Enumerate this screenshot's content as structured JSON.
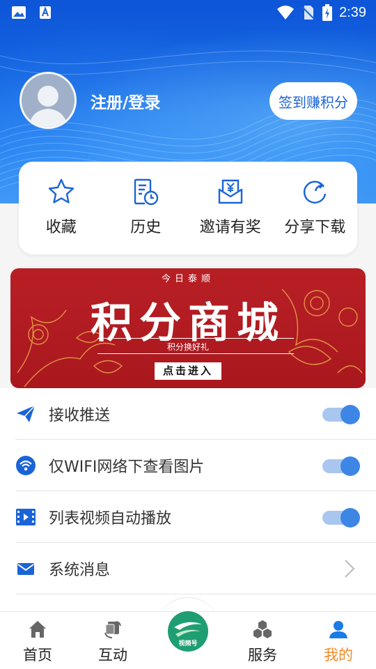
{
  "status_bar": {
    "time": "2:39",
    "icons": [
      "gallery-icon",
      "text-a-icon",
      "wifi-icon",
      "no-sim-icon",
      "battery-charging-icon"
    ]
  },
  "profile": {
    "login_text": "注册/登录",
    "signin_button": "签到赚积分"
  },
  "quick_actions": [
    {
      "label": "收藏",
      "icon": "star-icon"
    },
    {
      "label": "历史",
      "icon": "history-icon"
    },
    {
      "label": "邀请有奖",
      "icon": "invite-reward-icon"
    },
    {
      "label": "分享下载",
      "icon": "share-icon"
    }
  ],
  "banner": {
    "top_text": "今日泰顺",
    "title": "积分商城",
    "subtitle": "积分换好礼",
    "button": "点击进入"
  },
  "settings": [
    {
      "label": "接收推送",
      "icon": "send-icon",
      "control": "toggle",
      "on": true
    },
    {
      "label": "仅WIFI网络下查看图片",
      "icon": "wifi-circle-icon",
      "control": "toggle",
      "on": true
    },
    {
      "label": "列表视频自动播放",
      "icon": "video-icon",
      "control": "toggle",
      "on": true
    },
    {
      "label": "系统消息",
      "icon": "mail-icon",
      "control": "chevron"
    }
  ],
  "tabbar": [
    {
      "label": "首页",
      "icon": "home-icon"
    },
    {
      "label": "互动",
      "icon": "interaction-icon"
    },
    {
      "label": "视频号",
      "icon": "video-channel-logo"
    },
    {
      "label": "服务",
      "icon": "services-icon"
    },
    {
      "label": "我的",
      "icon": "user-icon",
      "active": true
    }
  ],
  "colors": {
    "accent_blue": "#1a64d8",
    "active_tab": "#f08a2c",
    "banner_red": "#b81f25",
    "toggle_knob": "#3d86e6"
  }
}
